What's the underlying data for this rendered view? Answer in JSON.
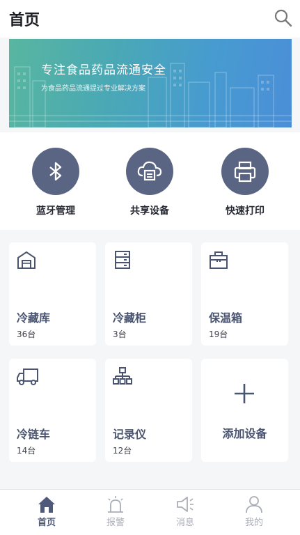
{
  "header": {
    "title": "首页"
  },
  "banner": {
    "title": "专注食品药品流通安全",
    "subtitle": "为食品药品流通提过专业解决方案"
  },
  "quick_actions": [
    {
      "label": "蓝牙管理",
      "icon": "bluetooth-icon"
    },
    {
      "label": "共享设备",
      "icon": "cloud-printer-icon"
    },
    {
      "label": "快速打印",
      "icon": "printer-icon"
    }
  ],
  "devices": [
    {
      "name": "冷藏库",
      "count": "36台",
      "icon": "warehouse-icon"
    },
    {
      "name": "冷藏柜",
      "count": "3台",
      "icon": "cabinet-icon"
    },
    {
      "name": "保温箱",
      "count": "19台",
      "icon": "box-icon"
    },
    {
      "name": "冷链车",
      "count": "14台",
      "icon": "truck-icon"
    },
    {
      "name": "记录仪",
      "count": "12台",
      "icon": "network-recorder-icon"
    }
  ],
  "add_device": {
    "label": "添加设备",
    "icon": "plus-icon"
  },
  "tabs": [
    {
      "label": "首页",
      "icon": "home-icon",
      "active": true
    },
    {
      "label": "报警",
      "icon": "alarm-icon",
      "active": false
    },
    {
      "label": "消息",
      "icon": "speaker-icon",
      "active": false
    },
    {
      "label": "我的",
      "icon": "user-icon",
      "active": false
    }
  ],
  "colors": {
    "accent": "#5a6483",
    "card_text": "#4a5470",
    "tab_active": "#4f5a7a",
    "tab_inactive": "#a9adb6"
  }
}
